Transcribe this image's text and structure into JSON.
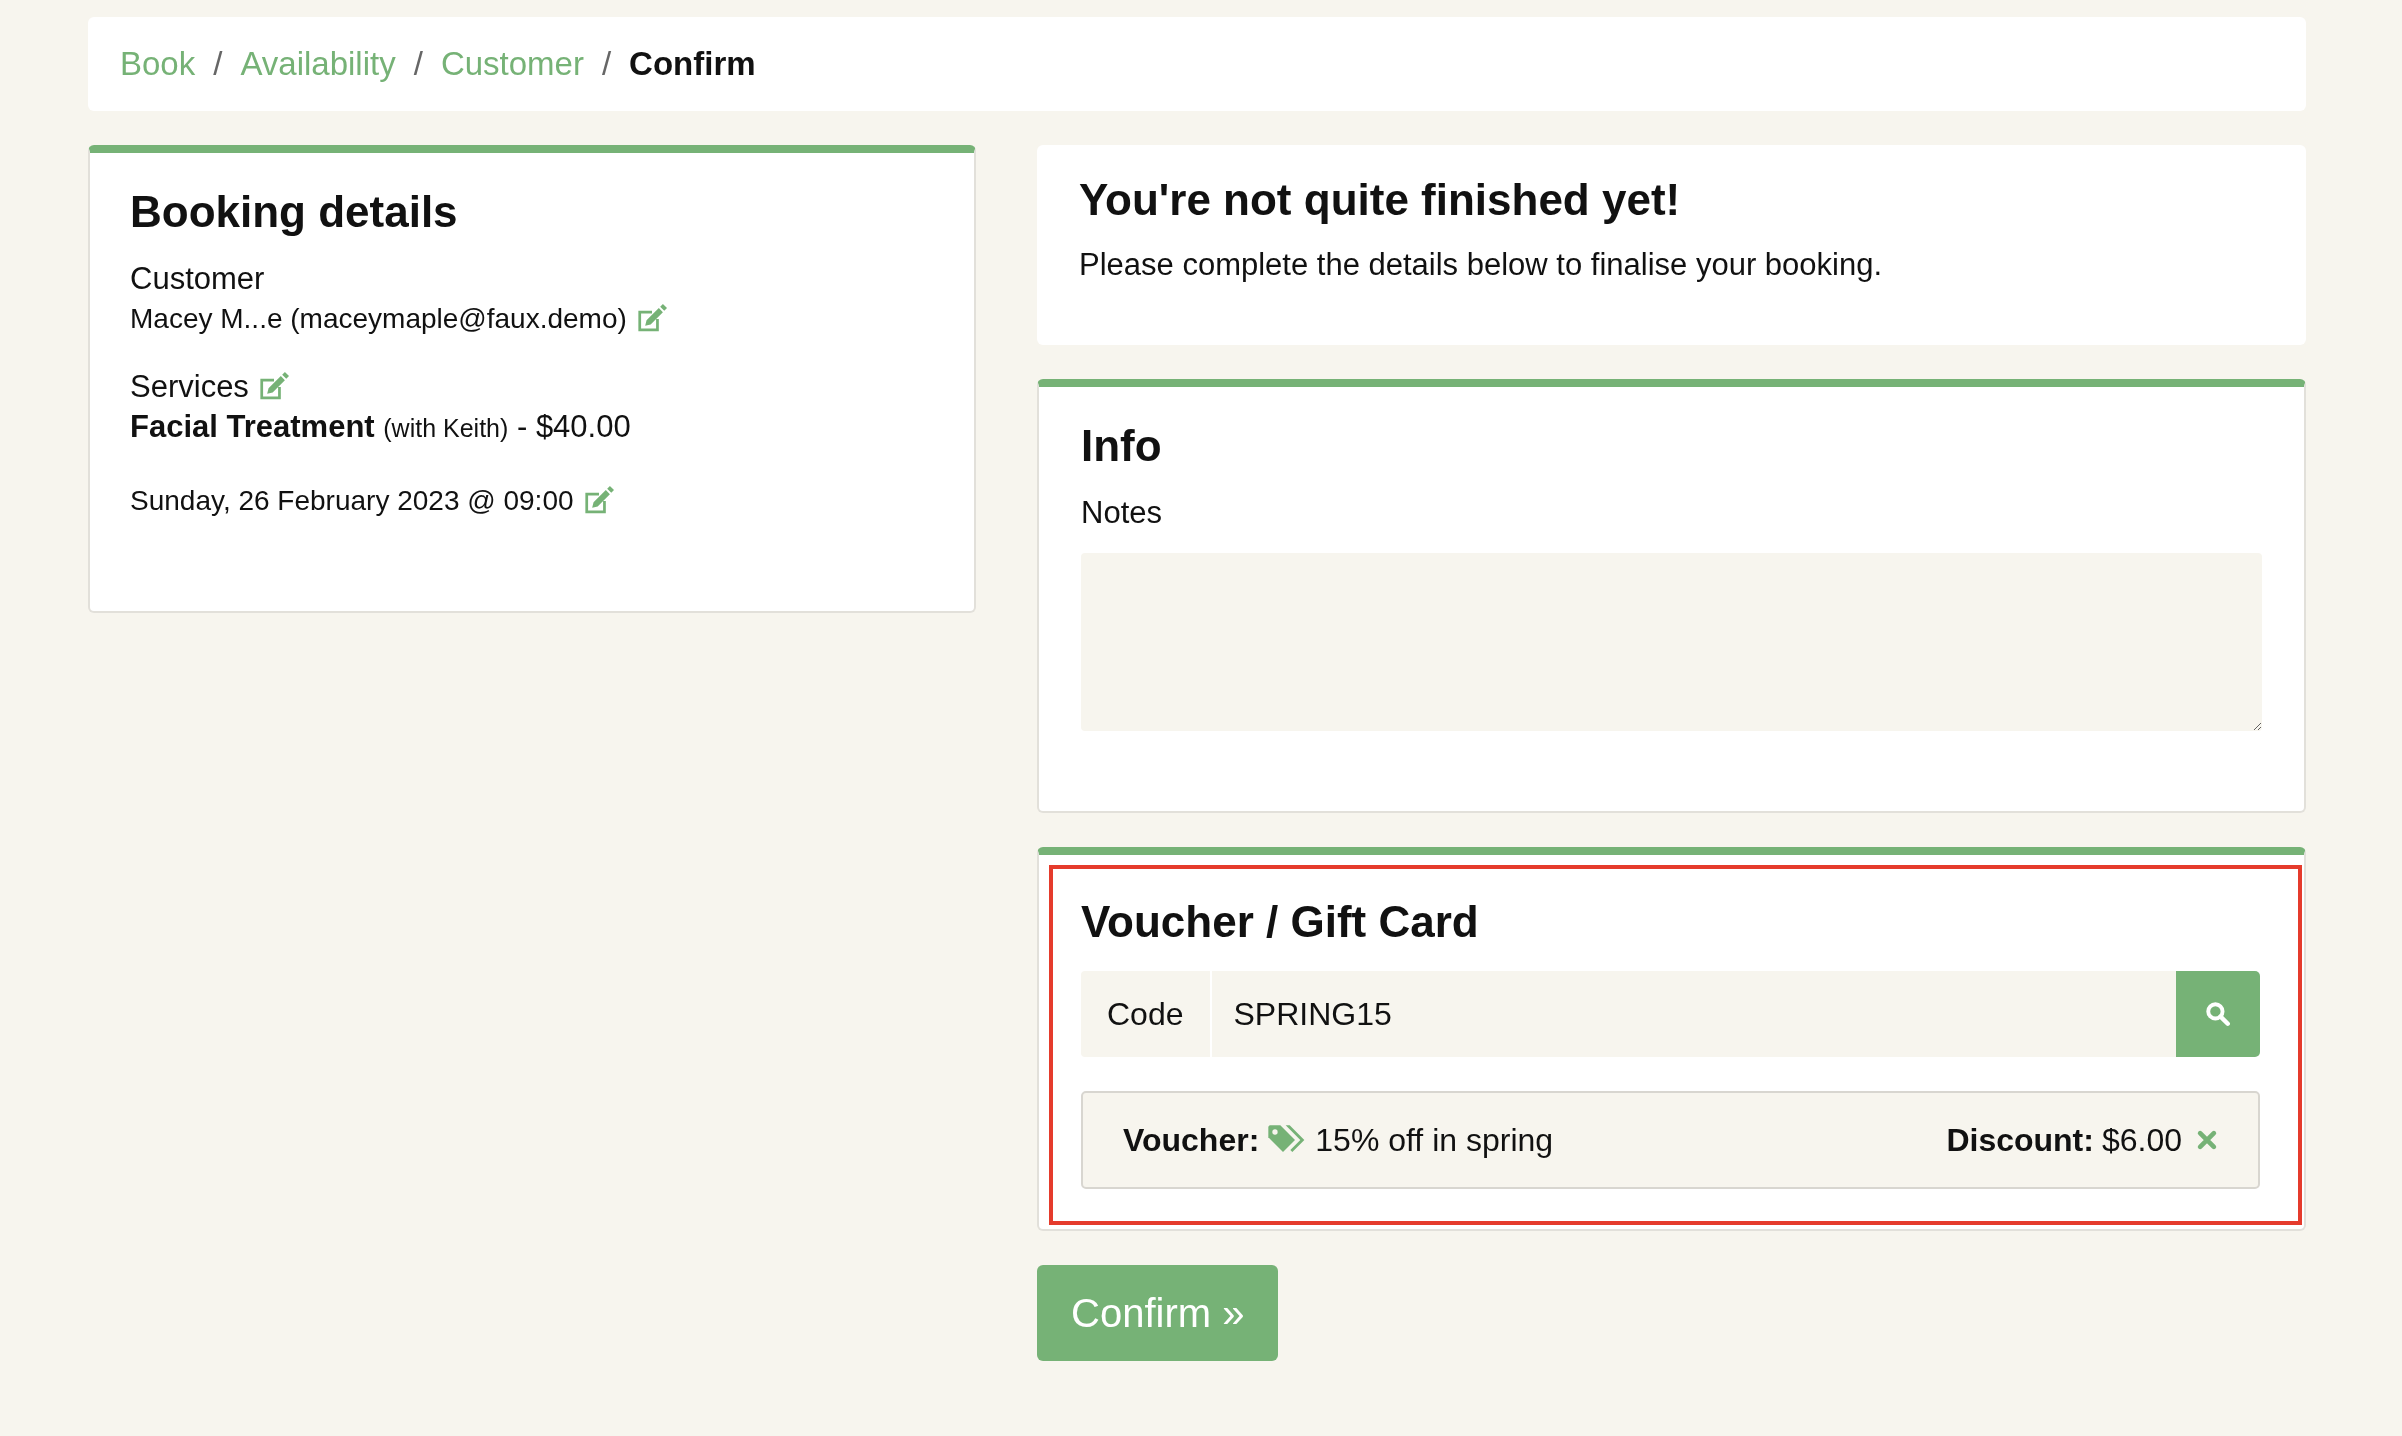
{
  "breadcrumb_separator": "/",
  "breadcrumb": [
    {
      "label": "Book",
      "selected": false
    },
    {
      "label": "Availability",
      "selected": false
    },
    {
      "label": "Customer",
      "selected": false
    },
    {
      "label": "Confirm",
      "selected": true
    }
  ],
  "booking": {
    "title": "Booking details",
    "customer_label": "Customer",
    "customer": "Macey M...e (maceymaple@faux.demo)",
    "services_label": "Services",
    "service_name": "Facial Treatment",
    "service_staff": "(with Keith)",
    "service_price": "- $40.00",
    "datetime": "Sunday, 26 February 2023 @ 09:00"
  },
  "notice": {
    "title": "You're not quite finished yet!",
    "text": "Please complete the details below to finalise your booking."
  },
  "info": {
    "title": "Info",
    "notes_label": "Notes"
  },
  "voucher": {
    "title": "Voucher / Gift Card",
    "highlighted": true,
    "code_label": "Code",
    "code_value": "SPRING15",
    "result_label": "Voucher:",
    "result_name": "15% off in spring",
    "discount_label": "Discount:",
    "discount_value": "$6.00"
  },
  "confirm_button": "Confirm »"
}
